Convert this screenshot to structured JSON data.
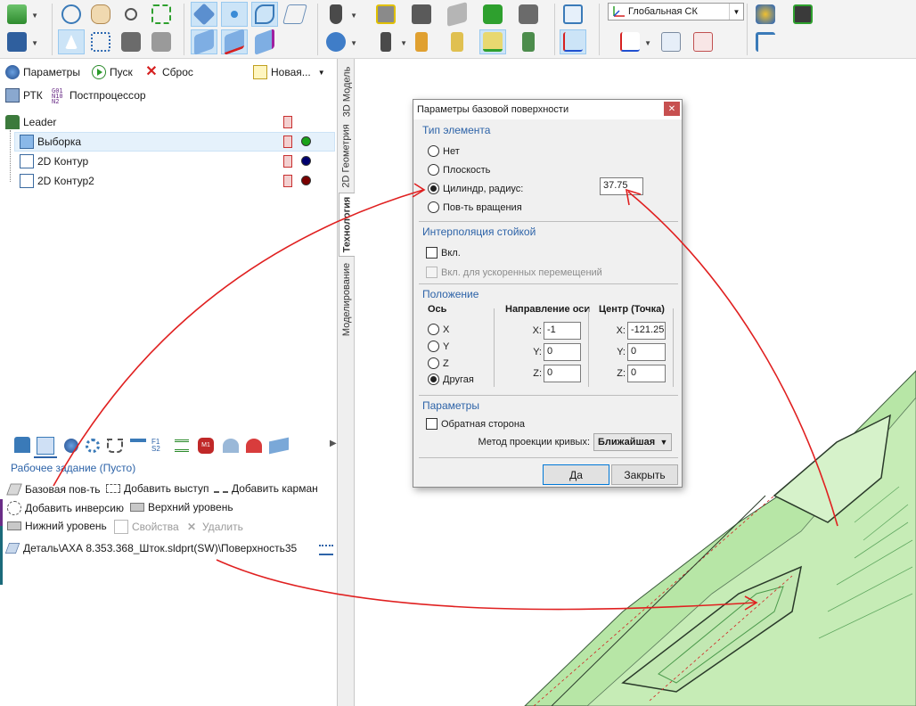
{
  "toolbar": {
    "coord_system_value": "Глобальная СК"
  },
  "panel": {
    "params_label": "Параметры",
    "run_label": "Пуск",
    "reset_label": "Сброс",
    "new_label": "Новая...",
    "rtk_label": "РТК",
    "postprocessor_label": "Постпроцессор"
  },
  "tree": {
    "root": "Leader",
    "items": [
      {
        "label": "Выборка",
        "status_color": "#1aa31a"
      },
      {
        "label": "2D Контур",
        "status_color": "#00006e"
      },
      {
        "label": "2D Контур2",
        "status_color": "#7a0000"
      }
    ]
  },
  "side_tabs": [
    "3D Модель",
    "2D Геометрия",
    "Технология",
    "Моделирование"
  ],
  "work_task": {
    "title": "Рабочее задание  (Пусто)",
    "actions": {
      "base_surface": "Базовая пов-ть",
      "add_boss": "Добавить выступ",
      "add_pocket": "Добавить карман",
      "add_inversion": "Добавить инверсию",
      "upper_level": "Верхний уровень",
      "lower_level": "Нижний уровень",
      "properties": "Свойства",
      "delete": "Удалить"
    },
    "item_path": "Деталь\\АХА 8.353.368_Шток.sldprt(SW)\\Поверхность35"
  },
  "dialog": {
    "title": "Параметры базовой поверхности",
    "element_type": {
      "heading": "Тип элемента",
      "options": [
        "Нет",
        "Плоскость",
        "Цилиндр, радиус:",
        "Пов-ть вращения"
      ],
      "radius": "37.75"
    },
    "interpolation": {
      "heading": "Интерполяция стойкой",
      "enabled_label": "Вкл.",
      "rapid_label": "Вкл. для ускоренных перемещений"
    },
    "position": {
      "heading": "Положение",
      "axis_header": "Ось",
      "axis_options": [
        "X",
        "Y",
        "Z",
        "Другая"
      ],
      "direction_header": "Направление оси",
      "center_header": "Центр (Точка)",
      "x_label": "X:",
      "y_label": "Y:",
      "z_label": "Z:",
      "dir_x": "-1",
      "dir_y": "0",
      "dir_z": "0",
      "center_x": "-121.25",
      "center_y": "0",
      "center_z": "0"
    },
    "params": {
      "heading": "Параметры",
      "reverse_label": "Обратная сторона",
      "method_label": "Метод проекции кривых:",
      "method_value": "Ближайшая"
    },
    "ok_label": "Да",
    "close_label": "Закрыть"
  },
  "colors": {
    "accent_blue": "#2d63a8",
    "annotation_red": "#e02020",
    "model_green": "#b7e6a6"
  }
}
